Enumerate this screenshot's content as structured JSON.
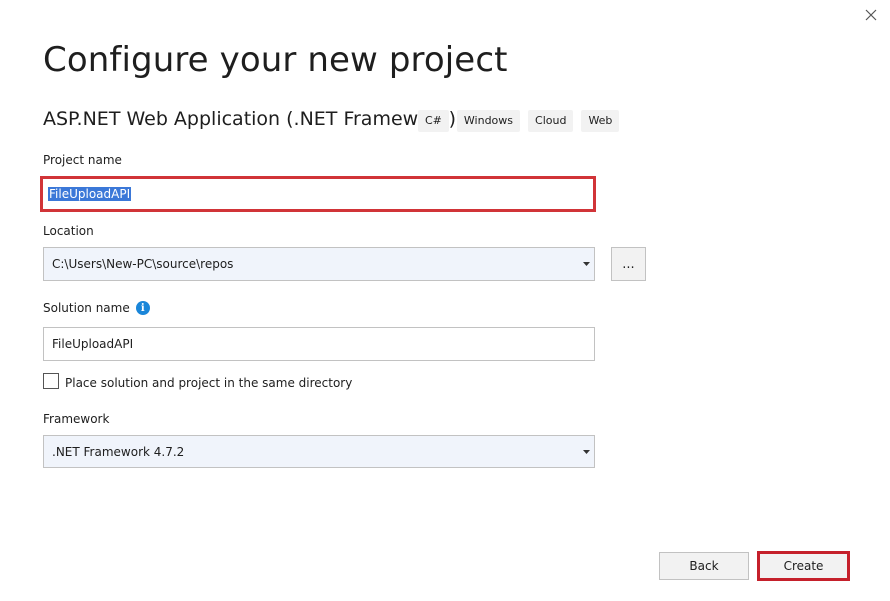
{
  "dialog": {
    "title": "Configure your new project",
    "template_name": "ASP.NET Web Application (.NET Framework)",
    "tags": [
      "C#",
      "Windows",
      "Cloud",
      "Web"
    ]
  },
  "project_name": {
    "label": "Project name",
    "value": "FileUploadAPI"
  },
  "location": {
    "label": "Location",
    "value": "C:\\Users\\New-PC\\source\\repos",
    "browse_label": "..."
  },
  "solution_name": {
    "label": "Solution name",
    "value": "FileUploadAPI",
    "info_icon": "i"
  },
  "same_directory": {
    "label": "Place solution and project in the same directory",
    "checked": false
  },
  "framework": {
    "label": "Framework",
    "value": ".NET Framework 4.7.2"
  },
  "buttons": {
    "back": "Back",
    "create": "Create"
  },
  "colors": {
    "accent_red": "#d13438",
    "info_blue": "#1a86d9",
    "selection_blue": "#3b78d8"
  },
  "icons": [
    "close-icon",
    "info-icon",
    "chevron-down-icon"
  ]
}
